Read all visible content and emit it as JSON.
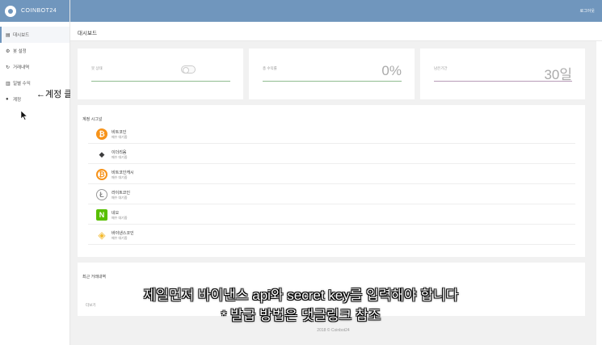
{
  "brand": {
    "name": "COINBOT24"
  },
  "topbar": {
    "logout": "로그아웃"
  },
  "sidebar": {
    "items": [
      {
        "icon": "dashboard-icon",
        "label": "대시보드",
        "active": true
      },
      {
        "icon": "gear-icon",
        "label": "봇 설정"
      },
      {
        "icon": "history-icon",
        "label": "거래내역"
      },
      {
        "icon": "chart-icon",
        "label": "일별 수익"
      },
      {
        "icon": "info-icon",
        "label": "계정"
      }
    ],
    "annotation": "←계정 클릭"
  },
  "page": {
    "title": "대시보드"
  },
  "stats": [
    {
      "label": "봇 상태",
      "value": "",
      "type": "toggle",
      "line_color": "#8fbc8f"
    },
    {
      "label": "총 수익률",
      "value": "0%",
      "line_color": "#8fbc8f"
    },
    {
      "label": "남은기간",
      "value": "30일",
      "line_color": "#b79bb7"
    }
  ],
  "signals": {
    "title": "계정 시그널",
    "coins": [
      {
        "name": "비트코인",
        "status": "매수 대기중",
        "icon": "bitcoin-icon",
        "color": "#f7931a",
        "glyph": "₿"
      },
      {
        "name": "이더리움",
        "status": "매수 대기중",
        "icon": "ethereum-icon",
        "color": "#3c3c3d",
        "glyph": "◆"
      },
      {
        "name": "비트코인캐시",
        "status": "매수 대기중",
        "icon": "bitcoin-cash-icon",
        "color": "#f7931a",
        "glyph": "◉"
      },
      {
        "name": "라이트코인",
        "status": "매수 대기중",
        "icon": "litecoin-icon",
        "color": "#9e9e9e",
        "glyph": "Ł"
      },
      {
        "name": "네오",
        "status": "매수 대기중",
        "icon": "neo-icon",
        "color": "#58bf00",
        "glyph": "N"
      },
      {
        "name": "바이낸스코인",
        "status": "매수 대기중",
        "icon": "binance-coin-icon",
        "color": "#f3ba2f",
        "glyph": "◈"
      }
    ]
  },
  "trades": {
    "title": "최근 거래내역",
    "more": "더보기"
  },
  "footer": "2018 © Coinbot24",
  "subtitles": {
    "line1": "제일먼저 바이낸스 api와 secret key를 입력해야 합니다",
    "line2": "* 발급 방법은 댓글링크 참조"
  },
  "colors": {
    "primary": "#7096bd",
    "background": "#f1f1f1"
  }
}
